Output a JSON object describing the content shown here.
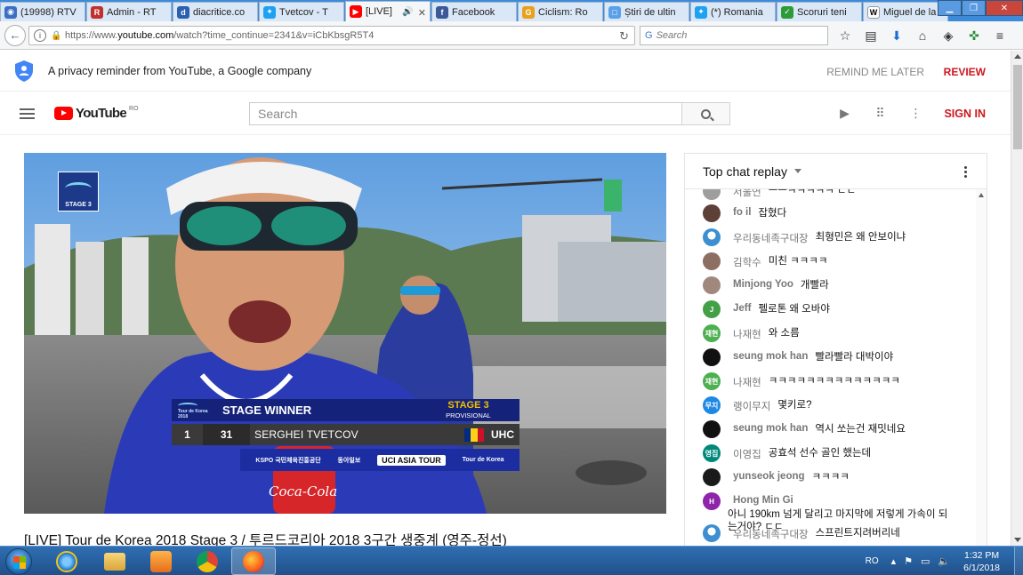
{
  "browser": {
    "tabs": [
      {
        "label": "(19998) RTV",
        "fav_color": "#3b6fc4",
        "fav_glyph": "◉"
      },
      {
        "label": "Admin - RT",
        "fav_color": "#c0302c",
        "fav_glyph": "R"
      },
      {
        "label": "diacritice.co",
        "fav_color": "#2b5fb0",
        "fav_glyph": "d"
      },
      {
        "label": "Tvetcov - T",
        "fav_color": "#1da1f2",
        "fav_glyph": "✦"
      },
      {
        "label": "[LIVE]",
        "fav_color": "#ff0000",
        "fav_glyph": "▶",
        "active": true
      },
      {
        "label": "Facebook",
        "fav_color": "#3b5998",
        "fav_glyph": "f"
      },
      {
        "label": "Ciclism: Ro",
        "fav_color": "#e8a11a",
        "fav_glyph": "G"
      },
      {
        "label": "Știri de ultin",
        "fav_color": "#5aa0e8",
        "fav_glyph": "□"
      },
      {
        "label": "(*) Romania",
        "fav_color": "#1da1f2",
        "fav_glyph": "✦"
      },
      {
        "label": "Scoruri teni",
        "fav_color": "#2e9b3a",
        "fav_glyph": "✓"
      },
      {
        "label": "Miguel de la",
        "fav_color": "#ffffff",
        "fav_glyph": "W"
      }
    ],
    "new_tab_label": "+",
    "url_prefix": "https://www.",
    "url_domain": "youtube.com",
    "url_path": "/watch?time_continue=2341&v=iCbKbsgR5T4",
    "search_placeholder": "Search",
    "search_engine_glyph": "G"
  },
  "privacy": {
    "text": "A privacy reminder from YouTube, a Google company",
    "remind_label": "REMIND ME LATER",
    "review_label": "REVIEW"
  },
  "youtube": {
    "logo_text": "YouTube",
    "region": "RO",
    "search_placeholder": "Search",
    "signin_label": "SIGN IN"
  },
  "video": {
    "badge_text": "STAGE 3",
    "badge_brand": "Tour de Korea",
    "lt_brand": "Tour de Korea 2018",
    "lt_title": "STAGE WINNER",
    "lt_stage": "STAGE 3",
    "lt_stage_sub": "PROVISIONAL",
    "rank": "1",
    "bib": "31",
    "rider": "SERGHEI TVETCOV",
    "team": "UHC",
    "sponsors": [
      "KSPO 국민체육진흥공단",
      "동아일보",
      "UCI ASIA TOUR",
      "Tour de Korea"
    ],
    "can_text": "Coca-Cola",
    "title": "[LIVE] Tour de Korea 2018 Stage 3 / 투르드코리아 2018 3구간 생중계 (영주-정선)"
  },
  "chat": {
    "header": "Top chat replay",
    "messages": [
      {
        "author": "서울연",
        "text": "ㅡㅡㅋㅋㅋㅋㅋ ㄷㄷ",
        "avatar_color": "#9e9e9e",
        "avatar_text": "",
        "bold": false,
        "partial": true
      },
      {
        "author": "fo il",
        "text": "잡혔다",
        "avatar_color": "#5d4037",
        "avatar_text": "",
        "bold": true
      },
      {
        "author": "우리동네족구대장",
        "text": "최형민은 왜 안보이냐",
        "avatar_color": "#3d8fd1",
        "avatar_text": "●",
        "bold": false
      },
      {
        "author": "김학수",
        "text": "미친 ㅋㅋㅋㅋ",
        "avatar_color": "#8d6e63",
        "avatar_text": "",
        "bold": false
      },
      {
        "author": "Minjong Yoo",
        "text": "개빨라",
        "avatar_color": "#a1887f",
        "avatar_text": "",
        "bold": true
      },
      {
        "author": "Jeff",
        "text": "펠로톤 왜 오바야",
        "avatar_color": "#43a047",
        "avatar_text": "J",
        "bold": true
      },
      {
        "author": "나재현",
        "text": "와 소름",
        "avatar_color": "#4caf50",
        "avatar_text": "재현",
        "bold": false
      },
      {
        "author": "seung mok han",
        "text": "빨라빨라 대박이야",
        "avatar_color": "#111111",
        "avatar_text": "",
        "bold": true
      },
      {
        "author": "나재현",
        "text": "ㅋㅋㅋㅋㅋㅋㅋㅋㅋㅋㅋㅋㅋㅋ",
        "avatar_color": "#4caf50",
        "avatar_text": "재현",
        "bold": false
      },
      {
        "author": "랭이무지",
        "text": "몇키로?",
        "avatar_color": "#1e88e5",
        "avatar_text": "무지",
        "bold": false
      },
      {
        "author": "seung mok han",
        "text": "역시 쏘는건 재밋네요",
        "avatar_color": "#111111",
        "avatar_text": "",
        "bold": true
      },
      {
        "author": "이영집",
        "text": "공효석 선수 골인 했는데",
        "avatar_color": "#00897b",
        "avatar_text": "영집",
        "bold": false
      },
      {
        "author": "yunseok jeong",
        "text": "ㅋㅋㅋㅋ",
        "avatar_color": "#1a1a1a",
        "avatar_text": "",
        "bold": true
      },
      {
        "author": "Hong Min Gi",
        "text": "아니 190km 넘게 달리고 마지막에 저렇게 가속이 되는거야? ㄷㄷ",
        "avatar_color": "#8e24aa",
        "avatar_text": "H",
        "bold": true
      },
      {
        "author": "우리동네족구대장",
        "text": "스프린트지려버리네",
        "avatar_color": "#3d8fd1",
        "avatar_text": "●",
        "bold": false
      }
    ]
  },
  "taskbar": {
    "lang": "RO",
    "time": "1:32 PM",
    "date": "6/1/2018"
  }
}
